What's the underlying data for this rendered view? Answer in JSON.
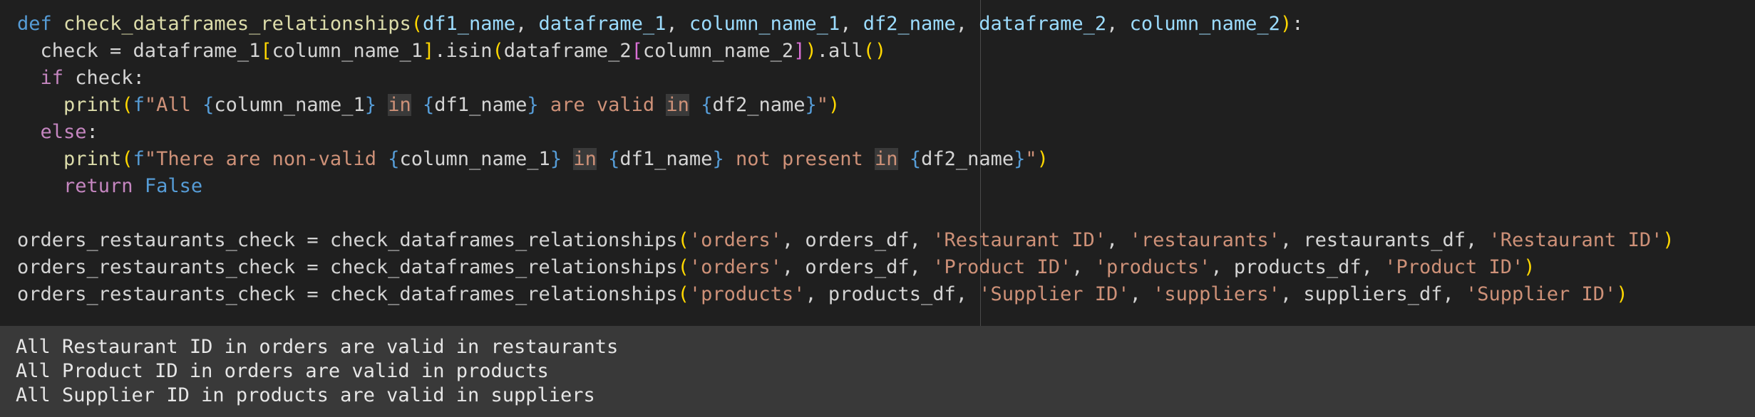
{
  "code": {
    "lines": [
      [
        {
          "t": "def",
          "c": "kw"
        },
        {
          "t": " ",
          "c": "txt"
        },
        {
          "t": "check_dataframes_relationships",
          "c": "fn"
        },
        {
          "t": "(",
          "c": "br1"
        },
        {
          "t": "df1_name",
          "c": "param"
        },
        {
          "t": ", ",
          "c": "txt"
        },
        {
          "t": "dataframe_1",
          "c": "param"
        },
        {
          "t": ", ",
          "c": "txt"
        },
        {
          "t": "column_name_1",
          "c": "param"
        },
        {
          "t": ", ",
          "c": "txt"
        },
        {
          "t": "df2_name",
          "c": "param"
        },
        {
          "t": ", ",
          "c": "txt"
        },
        {
          "t": "dataframe_2",
          "c": "param"
        },
        {
          "t": ", ",
          "c": "txt"
        },
        {
          "t": "column_name_2",
          "c": "param"
        },
        {
          "t": ")",
          "c": "br1"
        },
        {
          "t": ":",
          "c": "txt"
        }
      ],
      [
        {
          "t": "  check = dataframe_1",
          "c": "txt"
        },
        {
          "t": "[",
          "c": "br1"
        },
        {
          "t": "column_name_1",
          "c": "txt"
        },
        {
          "t": "]",
          "c": "br1"
        },
        {
          "t": ".isin",
          "c": "txt"
        },
        {
          "t": "(",
          "c": "br1"
        },
        {
          "t": "dataframe_2",
          "c": "txt"
        },
        {
          "t": "[",
          "c": "br2"
        },
        {
          "t": "column_name_2",
          "c": "txt"
        },
        {
          "t": "]",
          "c": "br2"
        },
        {
          "t": ")",
          "c": "br1"
        },
        {
          "t": ".all",
          "c": "txt"
        },
        {
          "t": "()",
          "c": "br1"
        }
      ],
      [
        {
          "t": "  ",
          "c": "txt"
        },
        {
          "t": "if",
          "c": "ctl"
        },
        {
          "t": " check:",
          "c": "txt"
        }
      ],
      [
        {
          "t": "    ",
          "c": "txt"
        },
        {
          "t": "print",
          "c": "fn"
        },
        {
          "t": "(",
          "c": "br1"
        },
        {
          "t": "f",
          "c": "kw"
        },
        {
          "t": "\"All ",
          "c": "str"
        },
        {
          "t": "{",
          "c": "kw"
        },
        {
          "t": "column_name_1",
          "c": "txt"
        },
        {
          "t": "}",
          "c": "kw"
        },
        {
          "t": " ",
          "c": "str"
        },
        {
          "t": "in",
          "c": "str",
          "h": true
        },
        {
          "t": " ",
          "c": "str"
        },
        {
          "t": "{",
          "c": "kw"
        },
        {
          "t": "df1_name",
          "c": "txt"
        },
        {
          "t": "}",
          "c": "kw"
        },
        {
          "t": " are valid ",
          "c": "str"
        },
        {
          "t": "in",
          "c": "str",
          "h": true
        },
        {
          "t": " ",
          "c": "str"
        },
        {
          "t": "{",
          "c": "kw"
        },
        {
          "t": "df2_name",
          "c": "txt"
        },
        {
          "t": "}",
          "c": "kw"
        },
        {
          "t": "\"",
          "c": "str"
        },
        {
          "t": ")",
          "c": "br1"
        }
      ],
      [
        {
          "t": "  ",
          "c": "txt"
        },
        {
          "t": "else",
          "c": "ctl"
        },
        {
          "t": ":",
          "c": "txt"
        }
      ],
      [
        {
          "t": "    ",
          "c": "txt"
        },
        {
          "t": "print",
          "c": "fn"
        },
        {
          "t": "(",
          "c": "br1"
        },
        {
          "t": "f",
          "c": "kw"
        },
        {
          "t": "\"There are non-valid ",
          "c": "str"
        },
        {
          "t": "{",
          "c": "kw"
        },
        {
          "t": "column_name_1",
          "c": "txt"
        },
        {
          "t": "}",
          "c": "kw"
        },
        {
          "t": " ",
          "c": "str"
        },
        {
          "t": "in",
          "c": "str",
          "h": true
        },
        {
          "t": " ",
          "c": "str"
        },
        {
          "t": "{",
          "c": "kw"
        },
        {
          "t": "df1_name",
          "c": "txt"
        },
        {
          "t": "}",
          "c": "kw"
        },
        {
          "t": " not present ",
          "c": "str"
        },
        {
          "t": "in",
          "c": "str",
          "h": true
        },
        {
          "t": " ",
          "c": "str"
        },
        {
          "t": "{",
          "c": "kw"
        },
        {
          "t": "df2_name",
          "c": "txt"
        },
        {
          "t": "}",
          "c": "kw"
        },
        {
          "t": "\"",
          "c": "str"
        },
        {
          "t": ")",
          "c": "br1"
        }
      ],
      [
        {
          "t": "    ",
          "c": "txt"
        },
        {
          "t": "return",
          "c": "ctl"
        },
        {
          "t": " ",
          "c": "txt"
        },
        {
          "t": "False",
          "c": "kw"
        }
      ],
      [],
      [
        {
          "t": "orders_restaurants_check = check_dataframes_relationships",
          "c": "txt"
        },
        {
          "t": "(",
          "c": "br1"
        },
        {
          "t": "'orders'",
          "c": "str"
        },
        {
          "t": ", orders_df, ",
          "c": "txt"
        },
        {
          "t": "'Restaurant ID'",
          "c": "str"
        },
        {
          "t": ", ",
          "c": "txt"
        },
        {
          "t": "'restaurants'",
          "c": "str"
        },
        {
          "t": ", restaurants_df, ",
          "c": "txt"
        },
        {
          "t": "'Restaurant ID'",
          "c": "str"
        },
        {
          "t": ")",
          "c": "br1"
        }
      ],
      [
        {
          "t": "orders_restaurants_check = check_dataframes_relationships",
          "c": "txt"
        },
        {
          "t": "(",
          "c": "br1"
        },
        {
          "t": "'orders'",
          "c": "str"
        },
        {
          "t": ", orders_df, ",
          "c": "txt"
        },
        {
          "t": "'Product ID'",
          "c": "str"
        },
        {
          "t": ", ",
          "c": "txt"
        },
        {
          "t": "'products'",
          "c": "str"
        },
        {
          "t": ", products_df, ",
          "c": "txt"
        },
        {
          "t": "'Product ID'",
          "c": "str"
        },
        {
          "t": ")",
          "c": "br1"
        }
      ],
      [
        {
          "t": "orders_restaurants_check = check_dataframes_relationships",
          "c": "txt"
        },
        {
          "t": "(",
          "c": "br1"
        },
        {
          "t": "'products'",
          "c": "str"
        },
        {
          "t": ", products_df, ",
          "c": "txt"
        },
        {
          "t": "'Supplier ID'",
          "c": "str"
        },
        {
          "t": ", ",
          "c": "txt"
        },
        {
          "t": "'suppliers'",
          "c": "str"
        },
        {
          "t": ", suppliers_df, ",
          "c": "txt"
        },
        {
          "t": "'Supplier ID'",
          "c": "str"
        },
        {
          "t": ")",
          "c": "br1"
        }
      ]
    ]
  },
  "output": {
    "lines": [
      "All Restaurant ID in orders are valid in restaurants",
      "All Product ID in orders are valid in products",
      "All Supplier ID in products are valid in suppliers"
    ]
  },
  "colors": {
    "editor_background": "#1f1f1f",
    "output_background": "#393939",
    "keyword": "#569cd6",
    "control_keyword": "#c586c0",
    "function": "#dcdcaa",
    "parameter": "#9cdcfe",
    "string": "#ce9178",
    "bracket_level_1": "#ffd700",
    "bracket_level_2": "#da70d6"
  }
}
